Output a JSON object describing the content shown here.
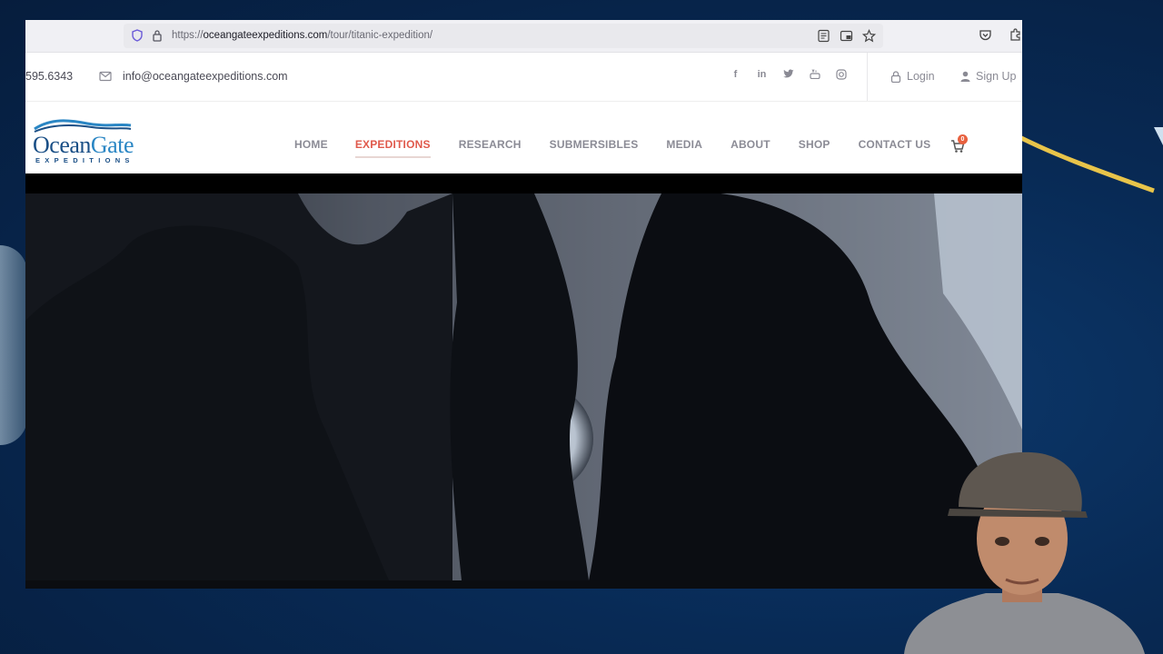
{
  "browser": {
    "url_prefix": "https://",
    "url_domain": "oceangateexpeditions.com",
    "url_path": "/tour/titanic-expedition/"
  },
  "topbar": {
    "phone": "595.6343",
    "email": "info@oceangateexpeditions.com",
    "social": [
      "f",
      "in",
      "t",
      "yt",
      "ig"
    ],
    "login_label": "Login",
    "signup_label": "Sign Up"
  },
  "logo": {
    "name_part1": "Ocean",
    "name_part2": "Gate",
    "subtitle": "EXPEDITIONS"
  },
  "nav": {
    "items": [
      "HOME",
      "EXPEDITIONS",
      "RESEARCH",
      "SUBMERSIBLES",
      "MEDIA",
      "ABOUT",
      "SHOP",
      "CONTACT US"
    ],
    "active": "EXPEDITIONS",
    "cart_count": "0"
  },
  "colors": {
    "accent": "#e05a4c",
    "brand_blue": "#1a4f86",
    "background": "#082a55"
  }
}
